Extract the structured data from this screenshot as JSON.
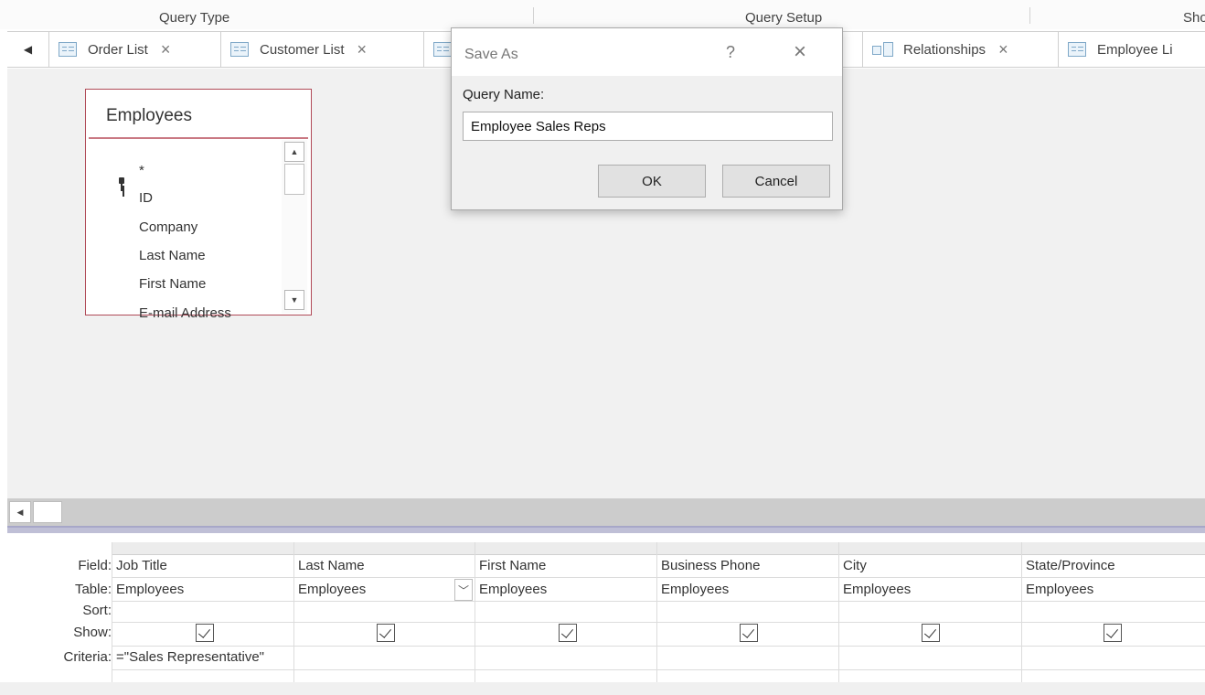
{
  "ribbon": {
    "groups": [
      "Query Type",
      "Query Setup",
      "Sho"
    ]
  },
  "tabs": [
    {
      "label": "Order List",
      "icon": "table-icon"
    },
    {
      "label": "Customer List",
      "icon": "table-icon"
    },
    {
      "label": "Relationships",
      "icon": "relationships-icon"
    },
    {
      "label": "Employee Li",
      "icon": "table-icon"
    }
  ],
  "close_glyph": "×",
  "field_list": {
    "title": "Employees",
    "fields": [
      "*",
      "ID",
      "Company",
      "Last Name",
      "First Name",
      "E-mail Address"
    ],
    "primary_key": "ID"
  },
  "grid": {
    "row_labels": [
      "Field:",
      "Table:",
      "Sort:",
      "Show:",
      "Criteria:"
    ],
    "columns": [
      {
        "field": "Job Title",
        "table": "Employees",
        "show": true,
        "criteria": "=\"Sales Representative\""
      },
      {
        "field": "Last Name",
        "table": "Employees",
        "show": true,
        "criteria": ""
      },
      {
        "field": "First Name",
        "table": "Employees",
        "show": true,
        "criteria": ""
      },
      {
        "field": "Business Phone",
        "table": "Employees",
        "show": true,
        "criteria": ""
      },
      {
        "field": "City",
        "table": "Employees",
        "show": true,
        "criteria": ""
      },
      {
        "field": "State/Province",
        "table": "Employees",
        "show": true,
        "criteria": ""
      }
    ]
  },
  "dialog": {
    "title": "Save As",
    "help_glyph": "?",
    "close_glyph": "×",
    "label": "Query Name:",
    "value": "Employee Sales Reps",
    "ok": "OK",
    "cancel": "Cancel"
  },
  "colors": {
    "table_border": "#b04a57",
    "splitter": "#bfbfd6",
    "design_bg": "#f1f1f1"
  }
}
